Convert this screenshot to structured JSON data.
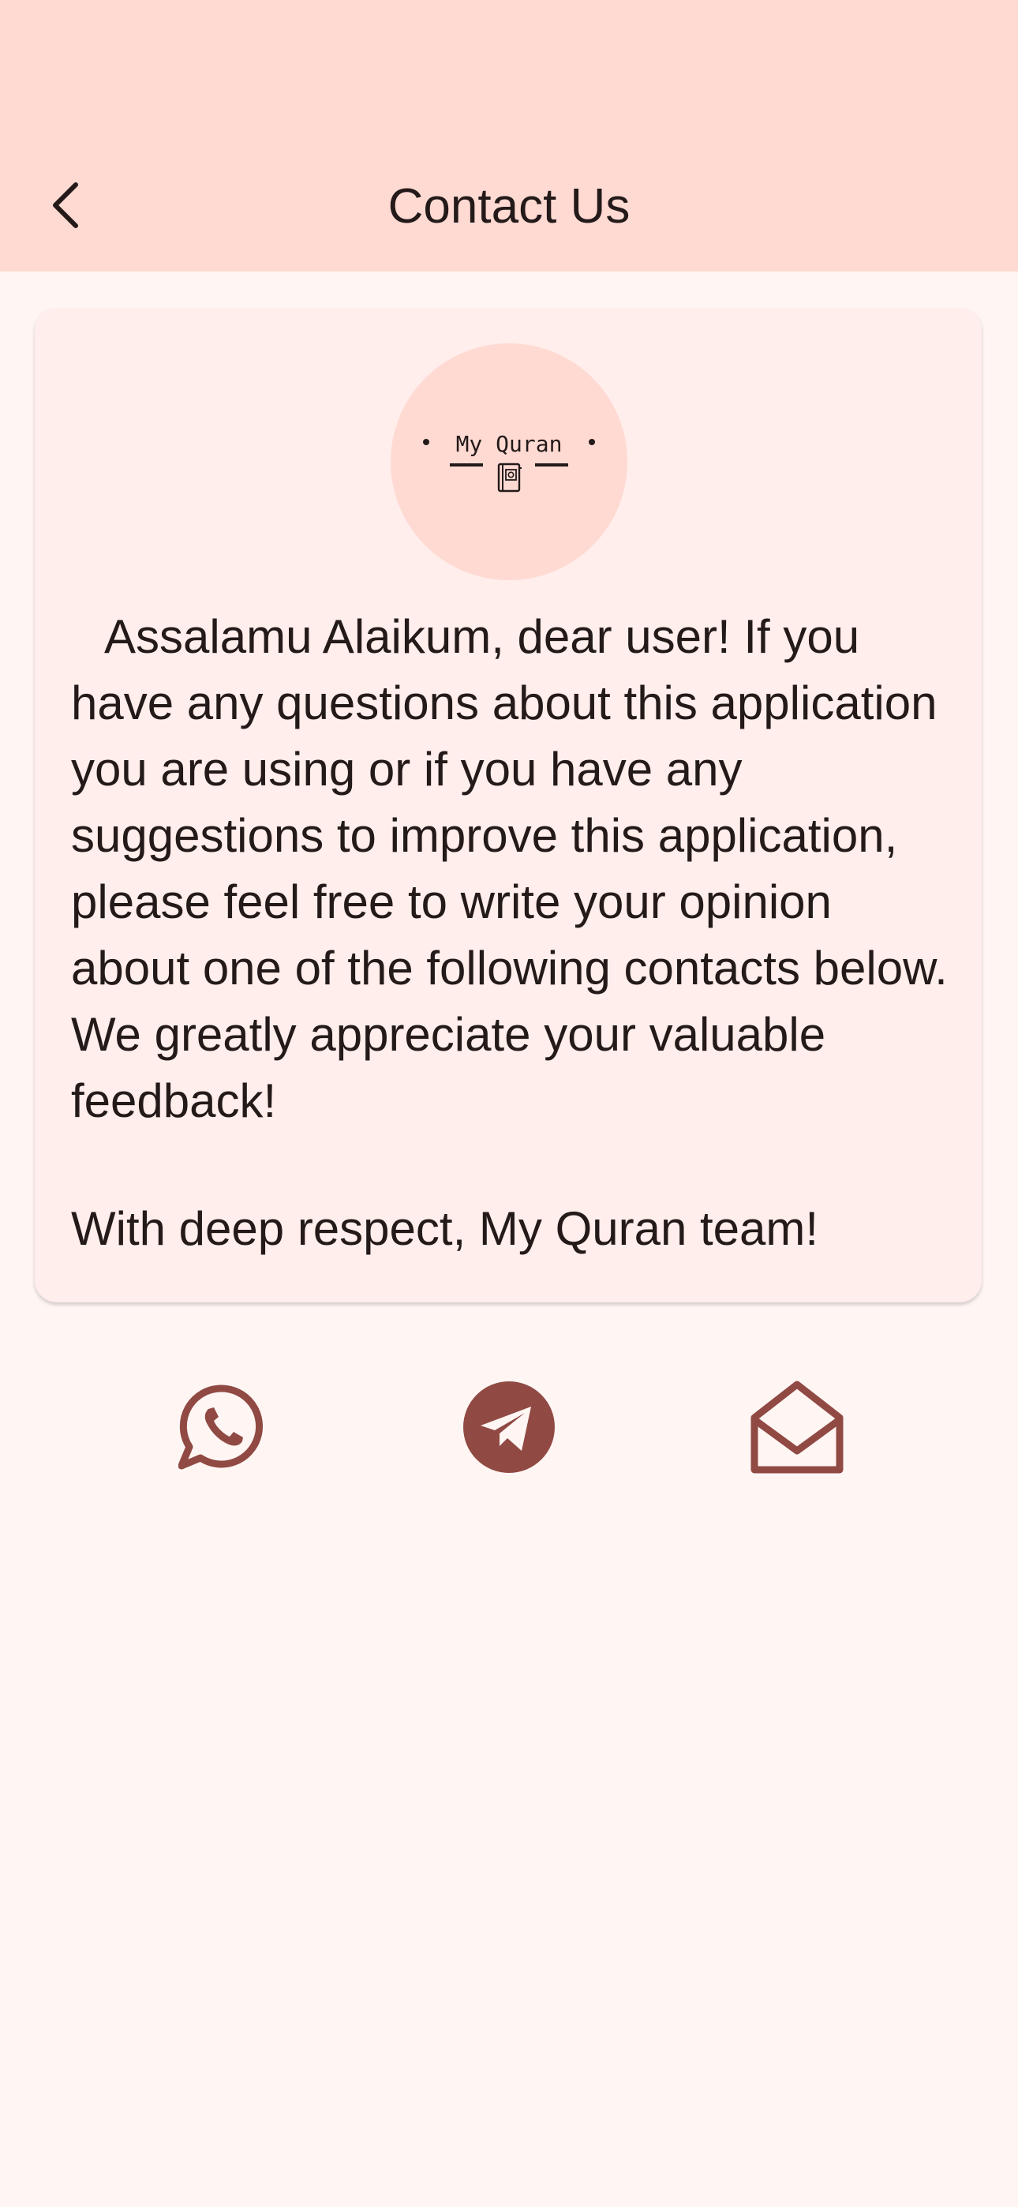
{
  "header": {
    "title": "Contact Us",
    "back_icon": "chevron-left-icon"
  },
  "card": {
    "logo": {
      "text": "My Quran",
      "icon": "quran-book-icon"
    },
    "message": "Assalamu Alaikum, dear user! If you have any questions about this application you are using or if you have any suggestions to improve this application, please feel free to write your opinion about one of the following contacts below. We greatly appreciate your valuable feedback!",
    "signature": "With deep respect, My Quran team!"
  },
  "contacts": [
    {
      "icon": "whatsapp-icon"
    },
    {
      "icon": "telegram-icon"
    },
    {
      "icon": "email-icon"
    }
  ],
  "colors": {
    "app_bar": "#FFDAD3",
    "background": "#FFF6F4",
    "card": "#FFEEEB",
    "accent": "#904A43",
    "text": "#231A19"
  }
}
